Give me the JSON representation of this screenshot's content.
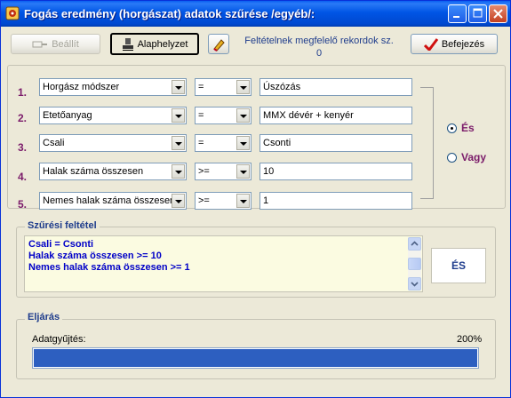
{
  "window": {
    "title": "Fogás eredmény (horgászat) adatok szűrése /egyéb/:"
  },
  "toolbar": {
    "apply_label": "Beállít",
    "reset_label": "Alaphelyzet",
    "matching_label": "Feltételnek megfelelő rekordok sz.",
    "matching_count": "0",
    "finish_label": "Befejezés"
  },
  "conditions": [
    {
      "num": "1.",
      "field": "Horgász módszer",
      "op": "=",
      "value": "Úszózás"
    },
    {
      "num": "2.",
      "field": "Etetőanyag",
      "op": "=",
      "value": "MMX dévér + kenyér"
    },
    {
      "num": "3.",
      "field": "Csali",
      "op": "=",
      "value": "Csonti"
    },
    {
      "num": "4.",
      "field": "Halak száma összesen",
      "op": ">=",
      "value": "10"
    },
    {
      "num": "5.",
      "field": "Nemes halak száma összesen",
      "op": ">=",
      "value": "1"
    }
  ],
  "logic": {
    "and_label": "És",
    "or_label": "Vagy",
    "selected": "and"
  },
  "filter": {
    "title": "Szűrési feltétel",
    "lines": [
      "Csali = Csonti",
      "Halak száma összesen >= 10",
      "Nemes halak száma összesen >= 1"
    ],
    "mode_label": "ÉS"
  },
  "process": {
    "title": "Eljárás",
    "label": "Adatgyűjtés:",
    "percent_text": "200%",
    "fill_fraction": 1.0
  },
  "colors": {
    "title_bar": "#0055e5",
    "accent_label": "#7b1c6a",
    "filter_text": "#0000c8",
    "progress": "#2d5fc0"
  }
}
